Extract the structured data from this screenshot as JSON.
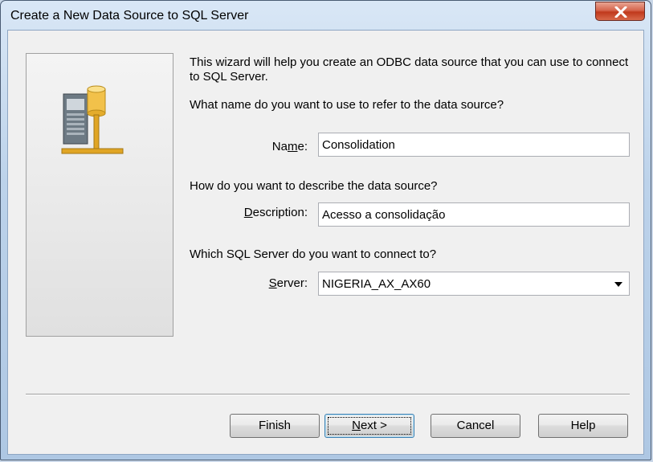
{
  "window": {
    "title": "Create a New Data Source to SQL Server",
    "close_label": "close"
  },
  "side_panel": {
    "icon": "server-database-icon"
  },
  "intro": "This wizard will help you create an ODBC data source that you can use to connect to SQL Server.",
  "name_section": {
    "question": "What name do you want to use to refer to the data source?",
    "label_pre": "Na",
    "label_accel": "m",
    "label_post": "e:",
    "value": "Consolidation"
  },
  "description_section": {
    "question": "How do you want to describe the data source?",
    "label_accel": "D",
    "label_post": "escription:",
    "value": "Acesso a consolidação"
  },
  "server_section": {
    "question": "Which SQL Server do you want to connect to?",
    "label_accel": "S",
    "label_post": "erver:",
    "value": "NIGERIA_AX_AX60"
  },
  "buttons": {
    "finish": "Finish",
    "next_accel": "N",
    "next_post": "ext >",
    "cancel": "Cancel",
    "help": "Help"
  }
}
